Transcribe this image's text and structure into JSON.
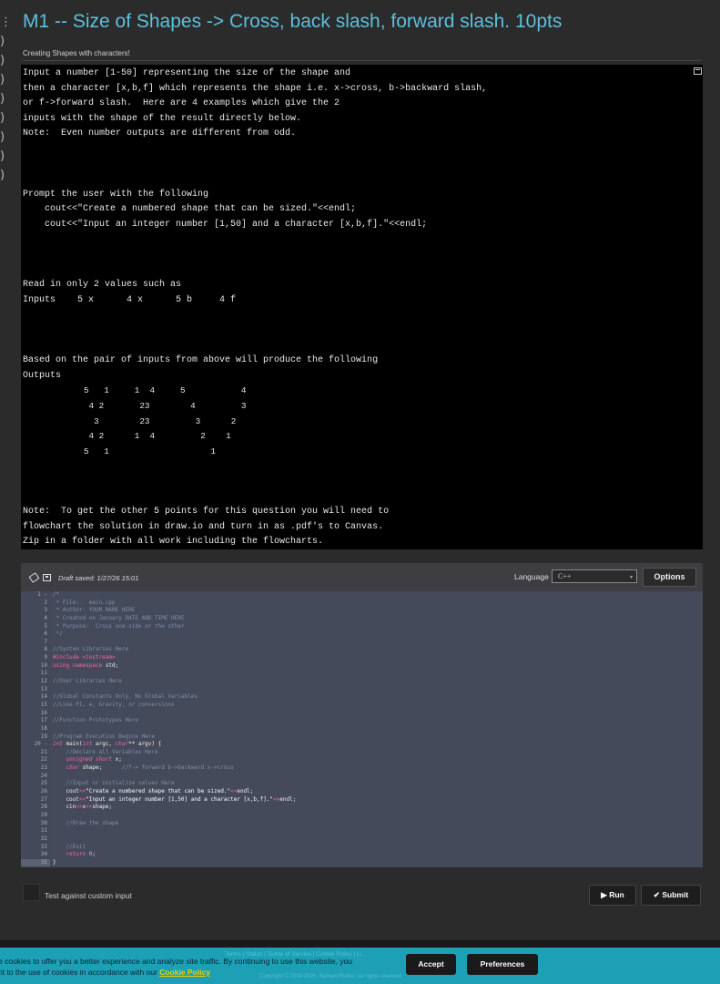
{
  "left_marks": [
    "⋮",
    ")",
    ")",
    ")",
    ")",
    ")",
    ")",
    ")",
    ")"
  ],
  "header": {
    "title": "M1 -- Size of Shapes -> Cross, back slash, forward slash. 10pts",
    "subtitle": "Creating Shapes with characters!"
  },
  "description_lines": [
    "Input a number [1-50] representing the size of the shape and",
    "then a character [x,b,f] which represents the shape i.e. x->cross, b->backward slash,",
    "or f->forward slash.  Here are 4 examples which give the 2",
    "inputs with the shape of the result directly below.",
    "Note:  Even number outputs are different from odd.",
    "",
    "",
    "",
    "Prompt the user with the following",
    "    cout<<\"Create a numbered shape that can be sized.\"<<endl;",
    "    cout<<\"Input an integer number [1,50] and a character [x,b,f].\"<<endl;",
    "",
    "",
    "",
    "Read in only 2 values such as",
    "Inputs    5 x      4 x      5 b     4 f",
    "",
    "",
    "",
    "Based on the pair of inputs from above will produce the following",
    "Outputs",
    "            5   1     1  4     5           4",
    "             4 2       23        4         3",
    "              3        23         3      2",
    "             4 2      1  4         2    1",
    "            5   1                    1",
    "",
    "",
    "",
    "Note:  To get the other 5 points for this question you will need to",
    "flowchart the solution in draw.io and turn in as .pdf's to Canvas.",
    "Zip in a folder with all work including the flowcharts."
  ],
  "editor": {
    "draft_saved": "Draft saved: 1/27/26 15:01",
    "language_label": "Language",
    "language_value": "C++",
    "options_label": "Options",
    "line_numbers": [
      "1 -",
      "2",
      "3",
      "4",
      "5",
      "6",
      "7",
      "8",
      "9",
      "10",
      "11",
      "12",
      "13",
      "14",
      "15",
      "16",
      "17",
      "18",
      "19",
      "20 -",
      "21",
      "22",
      "23",
      "24",
      "25",
      "26",
      "27",
      "28",
      "29",
      "30",
      "31",
      "32",
      "33",
      "34",
      "35"
    ],
    "code_lines": [
      "/*",
      " * File:   main.cpp",
      " * Author: YOUR NAME HERE",
      " * Created on January DATE AND TIME HERE",
      " * Purpose:  Cross one-side or the other",
      " */",
      "",
      "//System Libraries Here",
      "#include <iostream>",
      "using namespace std;",
      "",
      "//User Libraries Here",
      "",
      "//Global Constants Only, No Global Variables",
      "//Like PI, e, Gravity, or conversions",
      "",
      "//Function Prototypes Here",
      "",
      "//Program Execution Begins Here",
      "int main(int argc, char** argv) {",
      "    //Declare all Variables Here",
      "    unsigned short x;",
      "    char shape;      //f-> forward b->backward x->cross",
      "",
      "    //Input or initialize values Here",
      "    cout<<\"Create a numbered shape that can be sized.\"<<endl;",
      "    cout<<\"Input an integer number [1,50] and a character [x,b,f].\"<<endl;",
      "    cin>>x>>shape;",
      "",
      "    //Draw the shape",
      "",
      "",
      "    //Exit",
      "    return 0;",
      "}"
    ]
  },
  "custom_input_label": "Test against custom input",
  "run_label": "Run",
  "submit_label": "Submit",
  "footer": {
    "links": "Terms | Status | Terms of Service | Cookie Policy | Li...",
    "copyright": "Copyright © 2018-2026, Richard Rubec. All rights reserved."
  },
  "cookie": {
    "text_line1": "e cookies to offer you a better experience and analyze site traffic. By continuing to use this website, you",
    "text_line2": "nt to the use of cookies in accordance with our ",
    "link": "Cookie Policy",
    "accept": "Accept",
    "preferences": "Preferences"
  }
}
